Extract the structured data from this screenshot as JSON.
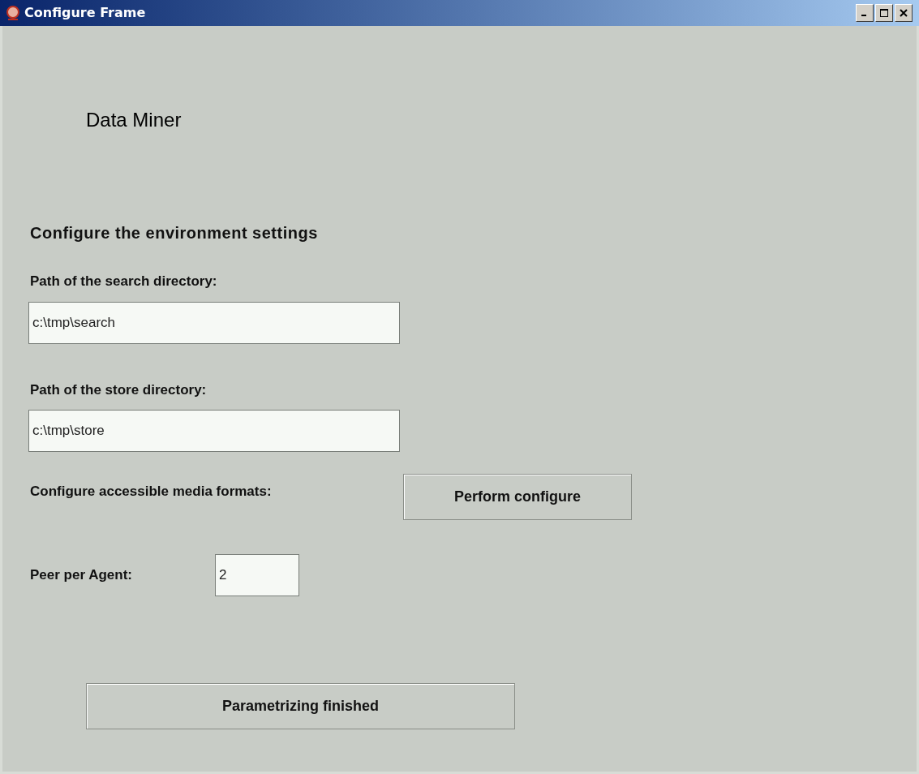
{
  "window": {
    "title": "Configure Frame"
  },
  "app_title": "Data Miner",
  "heading": "Configure the environment settings",
  "search_dir": {
    "label": "Path of the search directory:",
    "value": "c:\\tmp\\search"
  },
  "store_dir": {
    "label": "Path of the store directory:",
    "value": "c:\\tmp\\store"
  },
  "media": {
    "label": "Configure accessible media formats:",
    "button": "Perform configure"
  },
  "peers": {
    "label": "Peer per Agent:",
    "value": "2"
  },
  "finish_button": "Parametrizing finished"
}
